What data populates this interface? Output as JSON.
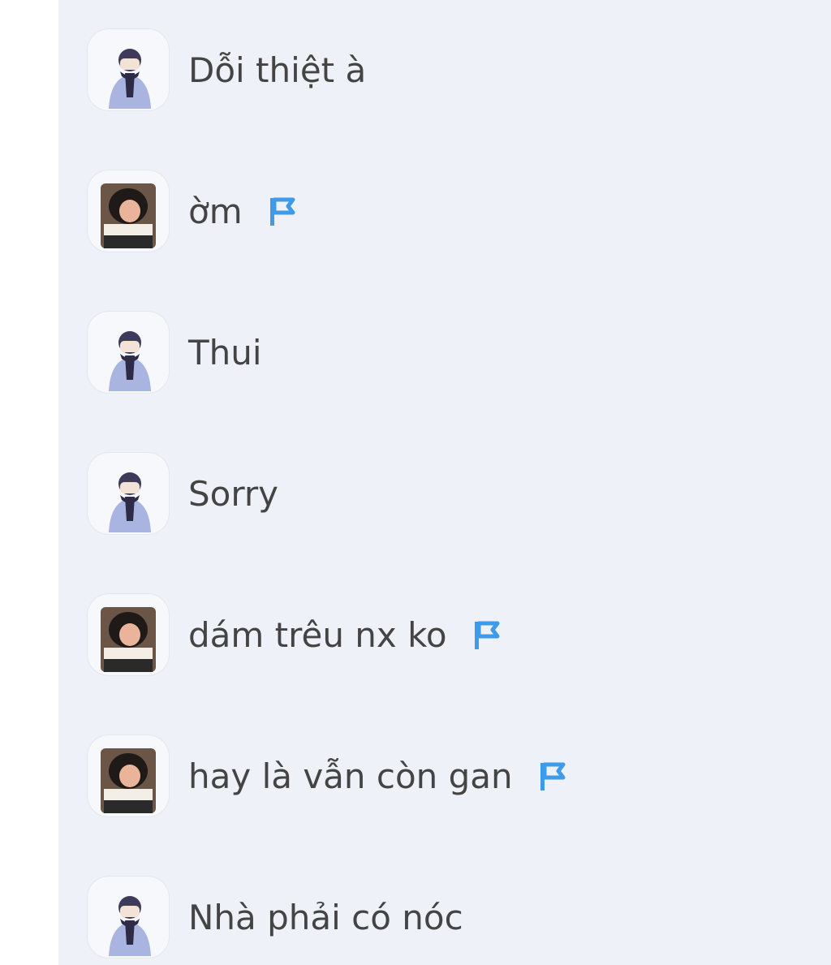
{
  "messages": [
    {
      "text": "Dỗi thiệt à",
      "avatar": "boy-avatar",
      "flag": false
    },
    {
      "text": "ờm",
      "avatar": "girl-avatar",
      "flag": true
    },
    {
      "text": "Thui",
      "avatar": "boy-avatar",
      "flag": false
    },
    {
      "text": "Sorry",
      "avatar": "boy-avatar",
      "flag": false
    },
    {
      "text": "dám trêu nx ko",
      "avatar": "girl-avatar",
      "flag": true
    },
    {
      "text": "hay là vẫn còn gan",
      "avatar": "girl-avatar",
      "flag": true
    },
    {
      "text": "Nhà phải có nóc",
      "avatar": "boy-avatar",
      "flag": false
    }
  ],
  "colors": {
    "panel_bg": "#eef2f8",
    "text": "#444444",
    "flag": "#3d9be9"
  }
}
